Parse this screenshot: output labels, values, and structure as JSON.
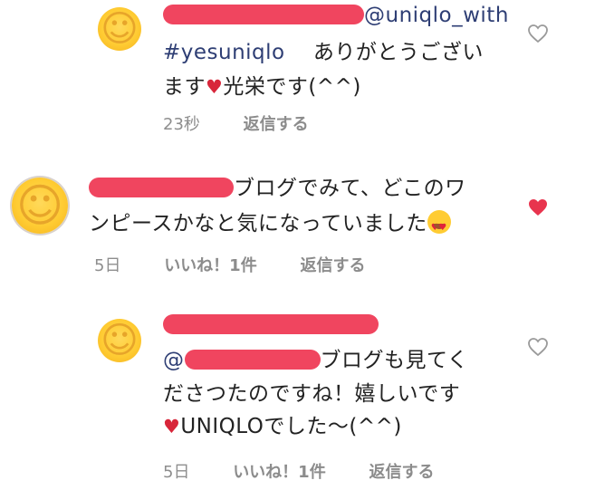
{
  "comments": [
    {
      "handle": "@uniqlo_with",
      "tag": "#yesuniqlo",
      "text1": "ありがとうござい",
      "text2a": "ます",
      "text2b": "光栄です(^^)",
      "time": "23秒",
      "reply_label": "返信する",
      "liked": false
    },
    {
      "text1": "ブログでみて、どこのワ",
      "text2": "ンピースかなと気になっていました",
      "time": "5日",
      "likes": "いいね！1件",
      "reply_label": "返信する",
      "liked": true
    },
    {
      "mention_prefix": "@",
      "text1": "ブログも見てく",
      "text2": "ださつたのですね！嬉しいです",
      "text3": "UNIQLOでした〜(^^)",
      "time": "5日",
      "likes": "いいね！1件",
      "reply_label": "返信する",
      "liked": false
    }
  ],
  "colors": {
    "redaction": "#f0455f",
    "heart_liked": "#e8344e",
    "heart_empty": "#9a9a9a",
    "link": "#2e3e74",
    "meta": "#8e8e8e"
  },
  "icons": [
    "smiley-avatar",
    "heart-outline-icon",
    "heart-filled-icon",
    "red-heart-emoji",
    "heart-eyes-emoji"
  ]
}
